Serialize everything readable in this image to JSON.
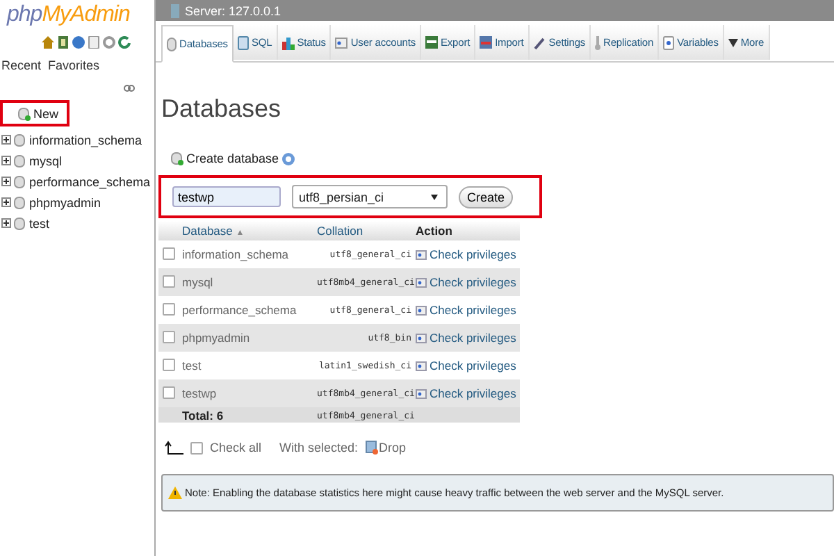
{
  "sidebar": {
    "logo": {
      "parts": [
        "php",
        "MyAdmin"
      ]
    },
    "tabs": [
      {
        "label": "Recent",
        "selected": false
      },
      {
        "label": "Favorites",
        "selected": false
      }
    ],
    "items": [
      {
        "kind": "new",
        "label": "New",
        "highlighted": true
      },
      {
        "kind": "database",
        "label": "information_schema",
        "expanded": false,
        "highlighted": false
      },
      {
        "kind": "database",
        "label": "mysql",
        "expanded": false,
        "highlighted": false
      },
      {
        "kind": "database",
        "label": "performance_schema",
        "expanded": false,
        "highlighted": false
      },
      {
        "kind": "database",
        "label": "phpmyadmin",
        "expanded": false,
        "highlighted": false
      },
      {
        "kind": "database",
        "label": "test",
        "expanded": false,
        "highlighted": false
      }
    ]
  },
  "server_bar": {
    "title": "Server: 127.0.0.1"
  },
  "tabs": [
    {
      "label": "Databases",
      "selected": true
    },
    {
      "label": "SQL",
      "selected": false
    },
    {
      "label": "Status",
      "selected": false
    },
    {
      "label": "User accounts",
      "selected": false
    },
    {
      "label": "Export",
      "selected": false
    },
    {
      "label": "Import",
      "selected": false
    },
    {
      "label": "Settings",
      "selected": false
    },
    {
      "label": "Replication",
      "selected": false
    },
    {
      "label": "Variables",
      "selected": false
    },
    {
      "label": "More",
      "selected": false
    }
  ],
  "page_title": "Databases",
  "create": {
    "label": "Create database",
    "name_value": "testwp",
    "collation_value": "utf8_persian_ci",
    "button": "Create",
    "highlighted": true
  },
  "table": {
    "columns": [
      "Database",
      "Collation",
      "Action"
    ],
    "sort_indicator": "▲",
    "rows": [
      {
        "database": "information_schema",
        "collation": "utf8_general_ci",
        "action": "Check privileges",
        "checked": false
      },
      {
        "database": "mysql",
        "collation": "utf8mb4_general_ci",
        "action": "Check privileges",
        "checked": false
      },
      {
        "database": "performance_schema",
        "collation": "utf8_general_ci",
        "action": "Check privileges",
        "checked": false
      },
      {
        "database": "phpmyadmin",
        "collation": "utf8_bin",
        "action": "Check privileges",
        "checked": false
      },
      {
        "database": "test",
        "collation": "latin1_swedish_ci",
        "action": "Check privileges",
        "checked": false
      },
      {
        "database": "testwp",
        "collation": "utf8mb4_general_ci",
        "action": "Check privileges",
        "checked": false
      }
    ],
    "total": {
      "label": "Total: 6",
      "collation": "utf8mb4_general_ci"
    }
  },
  "bulk": {
    "check_all": "Check all",
    "checked": false,
    "with_selected": "With selected:",
    "drop": "Drop"
  },
  "note": "Note: Enabling the database statistics here might cause heavy traffic between the web server and the MySQL server."
}
